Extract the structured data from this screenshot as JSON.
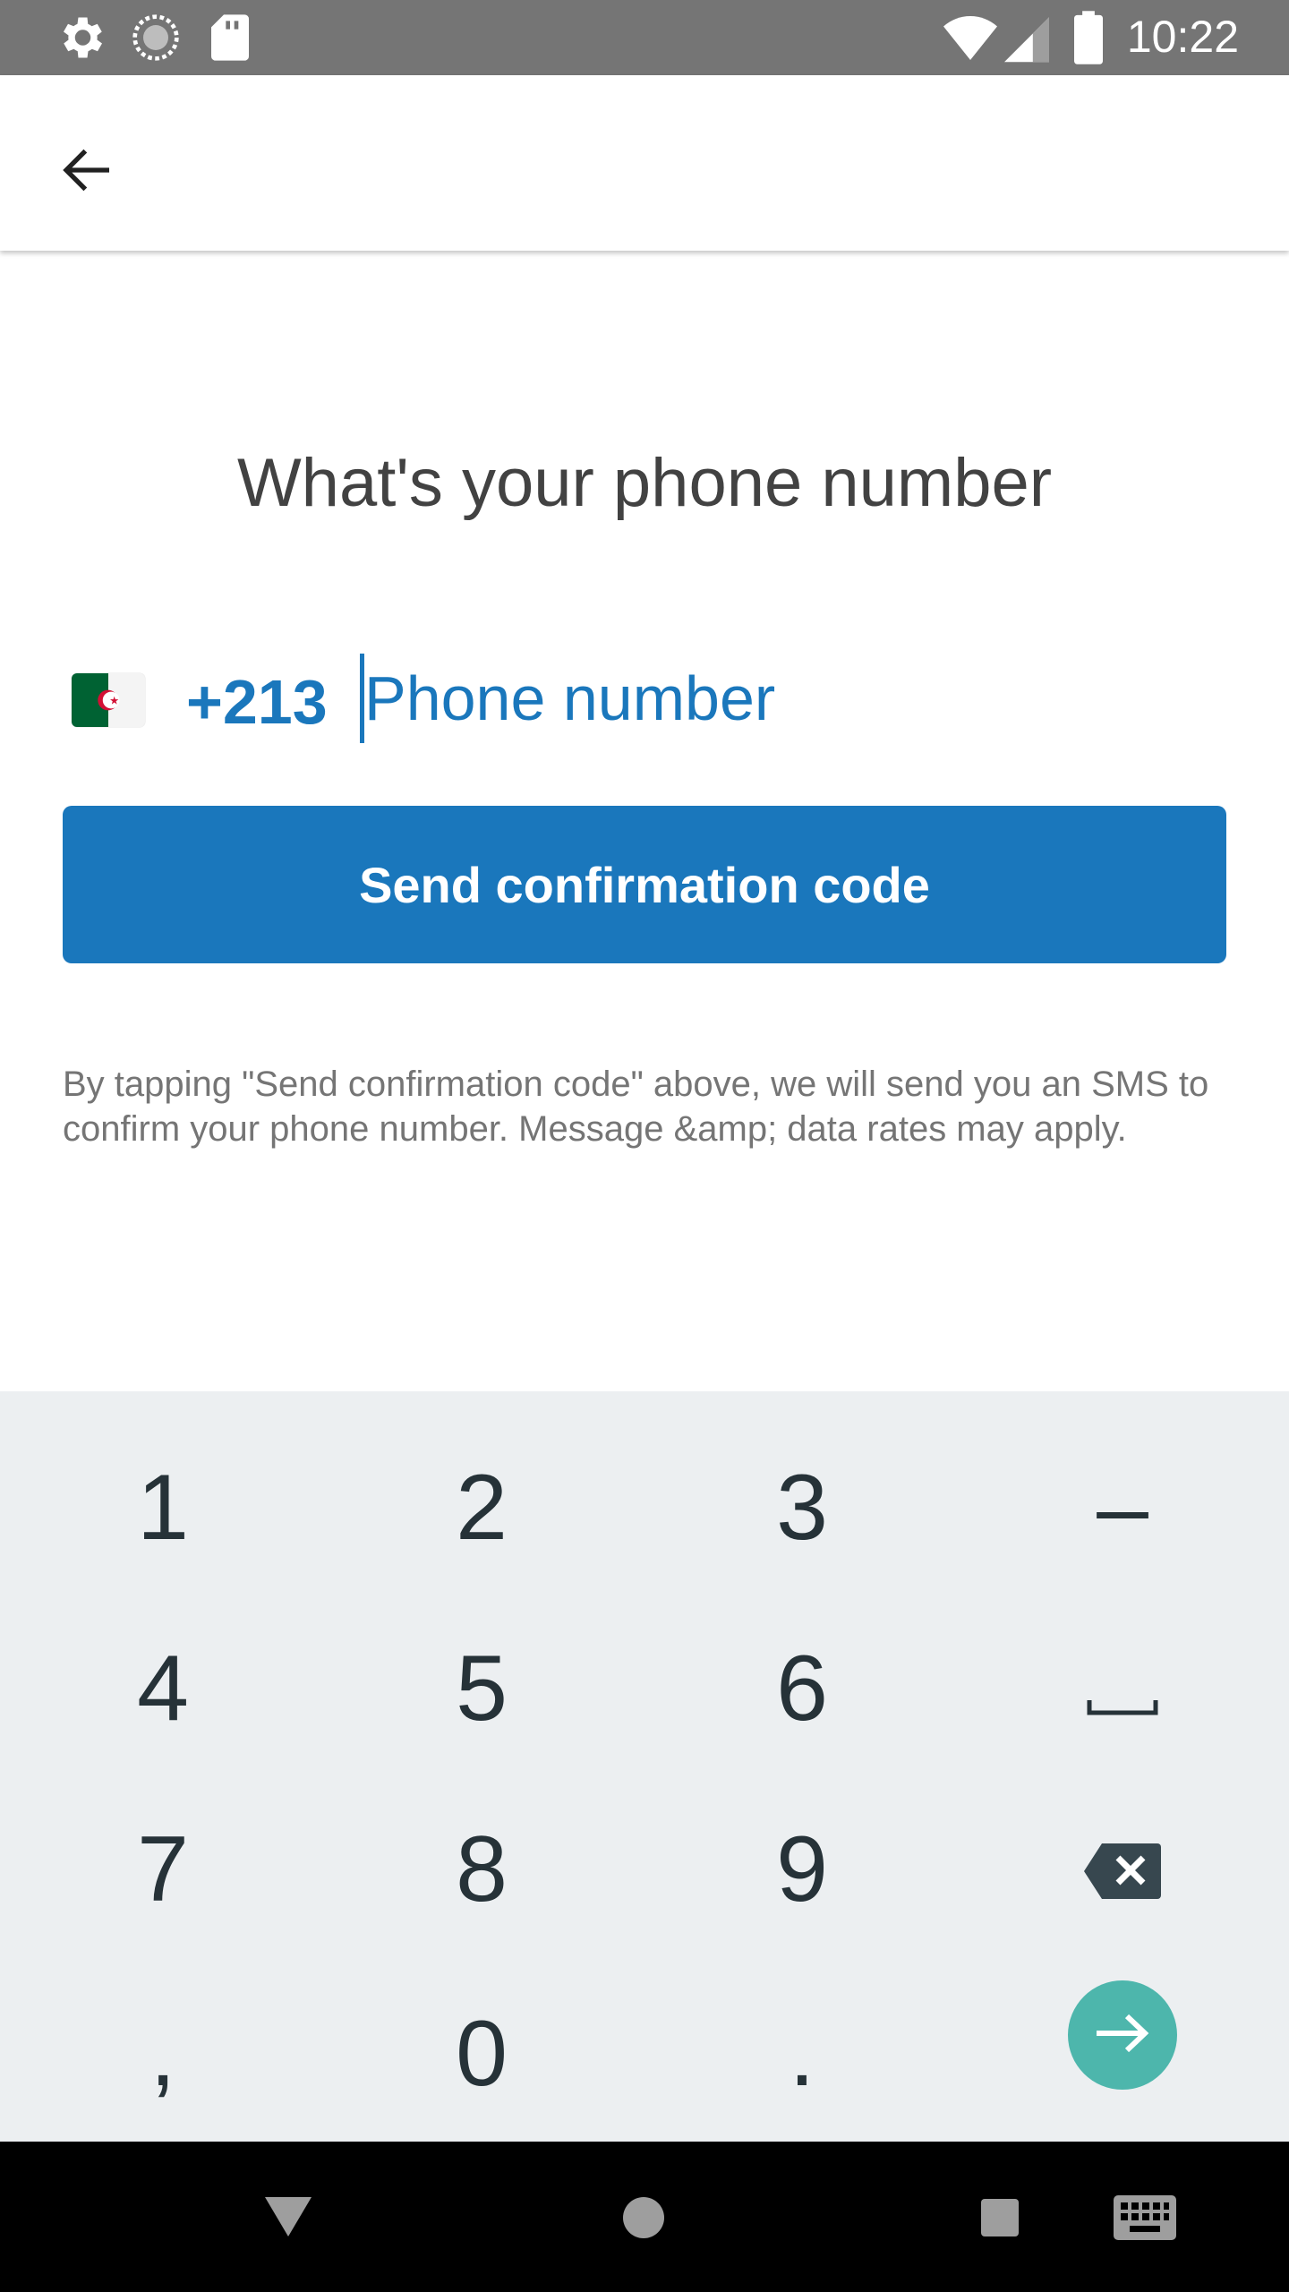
{
  "status_bar": {
    "time": "10:22",
    "left_icons": [
      "settings-icon",
      "sync-icon",
      "sd-card-icon"
    ],
    "right_icons": [
      "wifi-icon",
      "cell-signal-icon",
      "battery-icon"
    ]
  },
  "app_bar": {
    "back_icon": "arrow-left-icon"
  },
  "title": "What's your phone number",
  "phone": {
    "flag_icon": "algeria-flag-icon",
    "country_code": "+213",
    "placeholder": "Phone number",
    "value": ""
  },
  "send_button": {
    "label": "Send confirmation code"
  },
  "disclaimer": "By tapping \"Send confirmation code\" above, we will send you an SMS to confirm your phone number. Message &amp; data rates may apply.",
  "keypad": {
    "keys": [
      "1",
      "2",
      "3",
      "–",
      "4",
      "5",
      "6",
      "␣",
      "7",
      "8",
      "9",
      "⌫",
      ",",
      "0",
      ".",
      "→"
    ],
    "special_icons": {
      "space": "space-icon",
      "backspace": "backspace-icon",
      "go": "arrow-right-icon"
    }
  },
  "nav_bar": {
    "icons": [
      "back-triangle-icon",
      "home-circle-icon",
      "recents-square-icon",
      "keyboard-icon"
    ]
  },
  "colors": {
    "accent": "#1a77bc",
    "go_key": "#4db6ac",
    "keyboard_bg": "#eceff1",
    "status_bar": "#757575"
  }
}
